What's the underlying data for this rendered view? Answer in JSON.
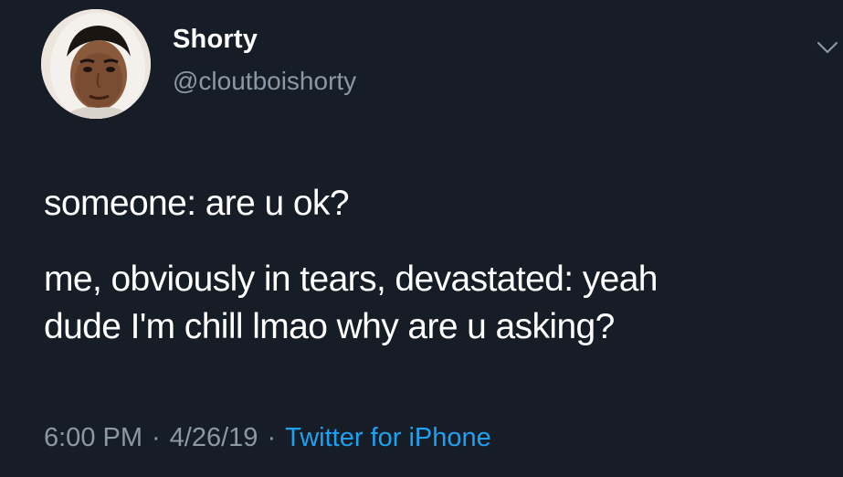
{
  "tweet": {
    "author": {
      "display_name": "Shorty",
      "handle": "@cloutboishorty"
    },
    "text_lines": [
      "someone: are u ok?",
      "me, obviously in tears, devastated: yeah",
      "dude I'm chill lmao why are u asking?"
    ],
    "time": "6:00 PM",
    "separator": "·",
    "date": "4/26/19",
    "source": "Twitter for iPhone"
  },
  "icons": {
    "menu": "chevron-down-icon",
    "avatar": "avatar"
  },
  "colors": {
    "background": "#161d27",
    "primary_text": "#ffffff",
    "secondary_text": "#8b98a5",
    "link": "#1da1f2"
  }
}
